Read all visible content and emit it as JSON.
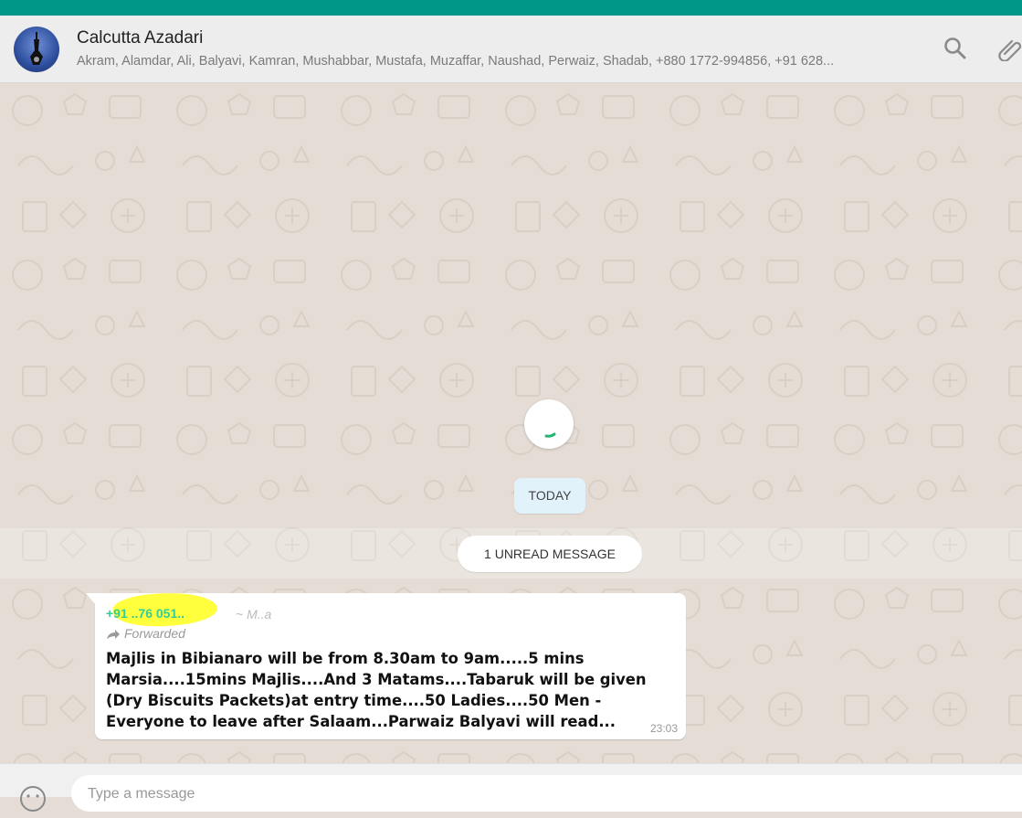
{
  "colors": {
    "accent": "#009688",
    "header_bg": "#ededed",
    "wallpaper": "#e5ddd5",
    "today_bg": "#e1f2fb",
    "sender": "#35cd96",
    "highlight": "#ffff33"
  },
  "header": {
    "title": "Calcutta Azadari",
    "members": "Akram, Alamdar, Ali, Balyavi, Kamran, Mushabbar, Mustafa, Muzaffar, Naushad, Perwaiz, Shadab, +880 1772-994856, +91 628...",
    "icons": [
      "search-icon",
      "attach-icon"
    ]
  },
  "chat": {
    "date_divider": "TODAY",
    "unread_banner": "1 UNREAD MESSAGE",
    "message": {
      "sender": "+91 ..76 051..",
      "push_name": "~ M..a",
      "forwarded_label": "Forwarded",
      "text": "Majlis in Bibianaro will be from 8.30am to 9am.....5 mins Marsia....15mins Majlis....And 3 Matams....Tabaruk will be given (Dry Biscuits Packets)at entry time....50 Ladies....50 Men - Everyone to leave after Salaam...Parwaiz Balyavi will read...",
      "time": "23:03"
    }
  },
  "composer": {
    "placeholder": "Type a message"
  }
}
